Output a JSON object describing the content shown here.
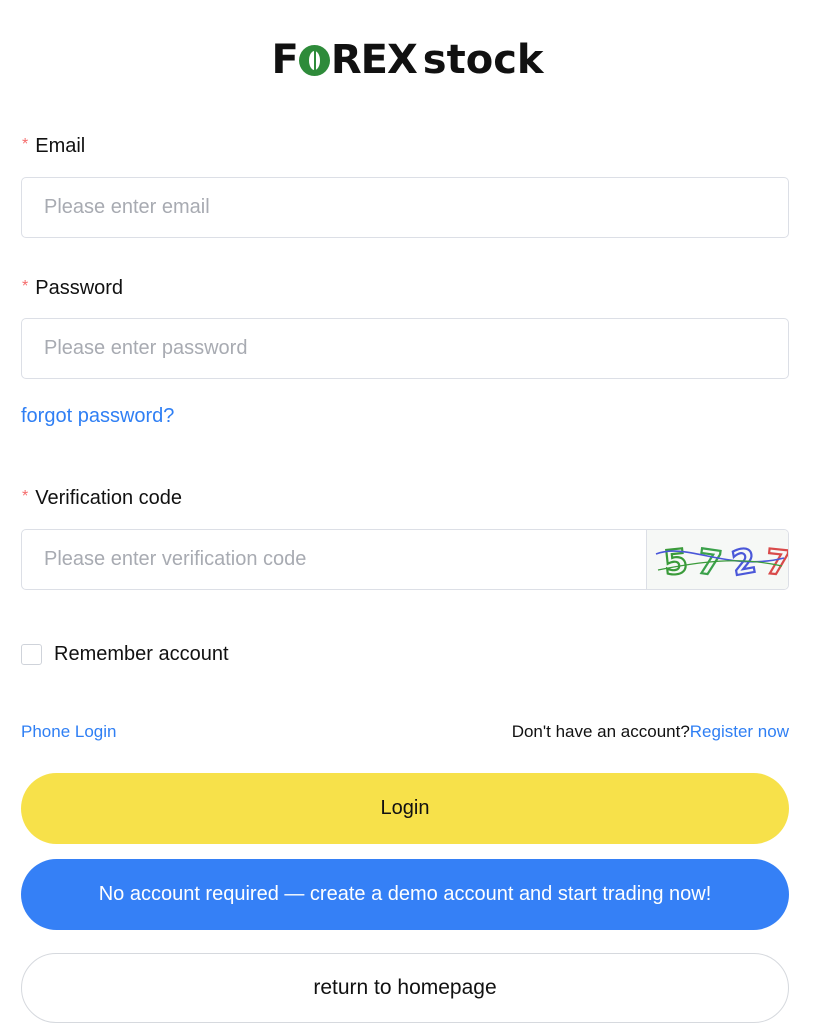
{
  "logo": {
    "prefix": "F",
    "suffix": "REX",
    "word": "stock",
    "brand_green": "#2e8b3a"
  },
  "form": {
    "email": {
      "required_mark": "*",
      "label": "Email",
      "placeholder": "Please enter email",
      "value": ""
    },
    "password": {
      "required_mark": "*",
      "label": "Password",
      "placeholder": "Please enter password",
      "value": ""
    },
    "forgot_password": "forgot password?",
    "verification": {
      "required_mark": "*",
      "label": "Verification code",
      "placeholder": "Please enter verification code",
      "value": "",
      "captcha_digits": [
        "5",
        "7",
        "2",
        "7"
      ],
      "captcha_colors": [
        "#3a9b3a",
        "#3aa14a",
        "#4a57d9",
        "#d94a4a"
      ]
    },
    "remember_label": "Remember account",
    "remember_checked": false
  },
  "links": {
    "phone_login": "Phone Login",
    "no_account_text": "Don't have an account?",
    "register_now": "Register now"
  },
  "buttons": {
    "login": "Login",
    "demo": "No account required — create a demo account and start trading now!",
    "return_home": "return to homepage"
  },
  "colors": {
    "accent_blue": "#2f7ff4",
    "login_yellow": "#f7e14a",
    "demo_blue": "#3580f6",
    "required_red": "#f56c6c"
  }
}
